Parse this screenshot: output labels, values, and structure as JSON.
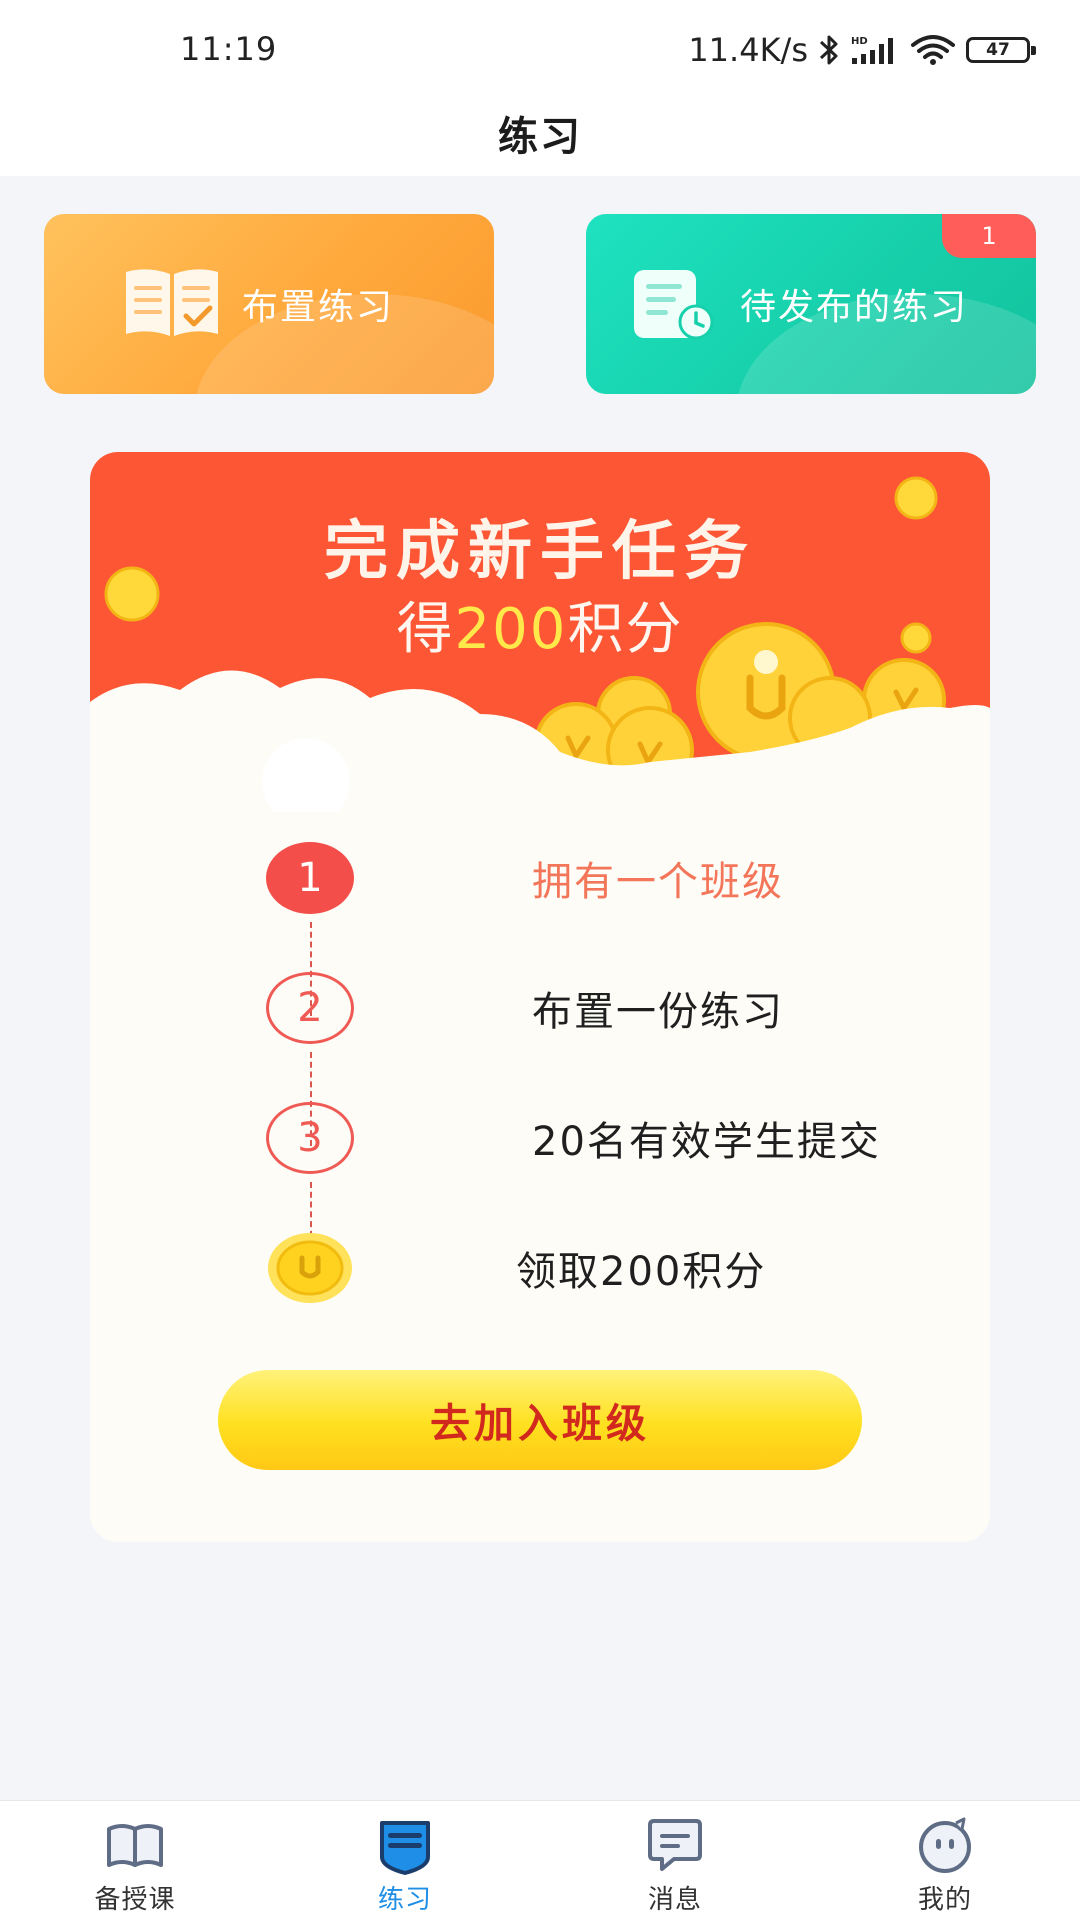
{
  "status_bar": {
    "time": "11:19",
    "network_speed": "11.4K/s",
    "battery_level": "47",
    "icons": [
      "bluetooth-icon",
      "hd-signal-icon",
      "wifi-icon",
      "battery-icon"
    ]
  },
  "header": {
    "title": "练习"
  },
  "cards": {
    "assign": {
      "label": "布置练习",
      "icon": "book-check-icon"
    },
    "pending": {
      "label": "待发布的练习",
      "badge": "1",
      "icon": "clock-document-icon"
    }
  },
  "task": {
    "title": "完成新手任务",
    "subtitle_prefix": "得",
    "subtitle_points": "200",
    "subtitle_suffix": "积分",
    "steps": [
      {
        "number": "1",
        "text": "拥有一个班级",
        "status": "done"
      },
      {
        "number": "2",
        "text": "布置一份练习",
        "status": "todo"
      },
      {
        "number": "3",
        "text": "20名有效学生提交",
        "status": "todo"
      }
    ],
    "reward_text": "领取200积分",
    "button_label": "去加入班级"
  },
  "tabbar": {
    "items": [
      {
        "label": "备授课",
        "icon": "open-book-icon",
        "active": false
      },
      {
        "label": "练习",
        "icon": "practice-icon",
        "active": true
      },
      {
        "label": "消息",
        "icon": "message-icon",
        "active": false
      },
      {
        "label": "我的",
        "icon": "profile-face-icon",
        "active": false
      }
    ]
  },
  "colors": {
    "accent_blue": "#1e8ee6",
    "banner_red": "#fc5635",
    "card_orange": "#ffa93c",
    "card_teal": "#17d0ab",
    "button_yellow": "#ffe01f",
    "button_text_red": "#d1291d",
    "highlight_yellow": "#ffe94a"
  }
}
